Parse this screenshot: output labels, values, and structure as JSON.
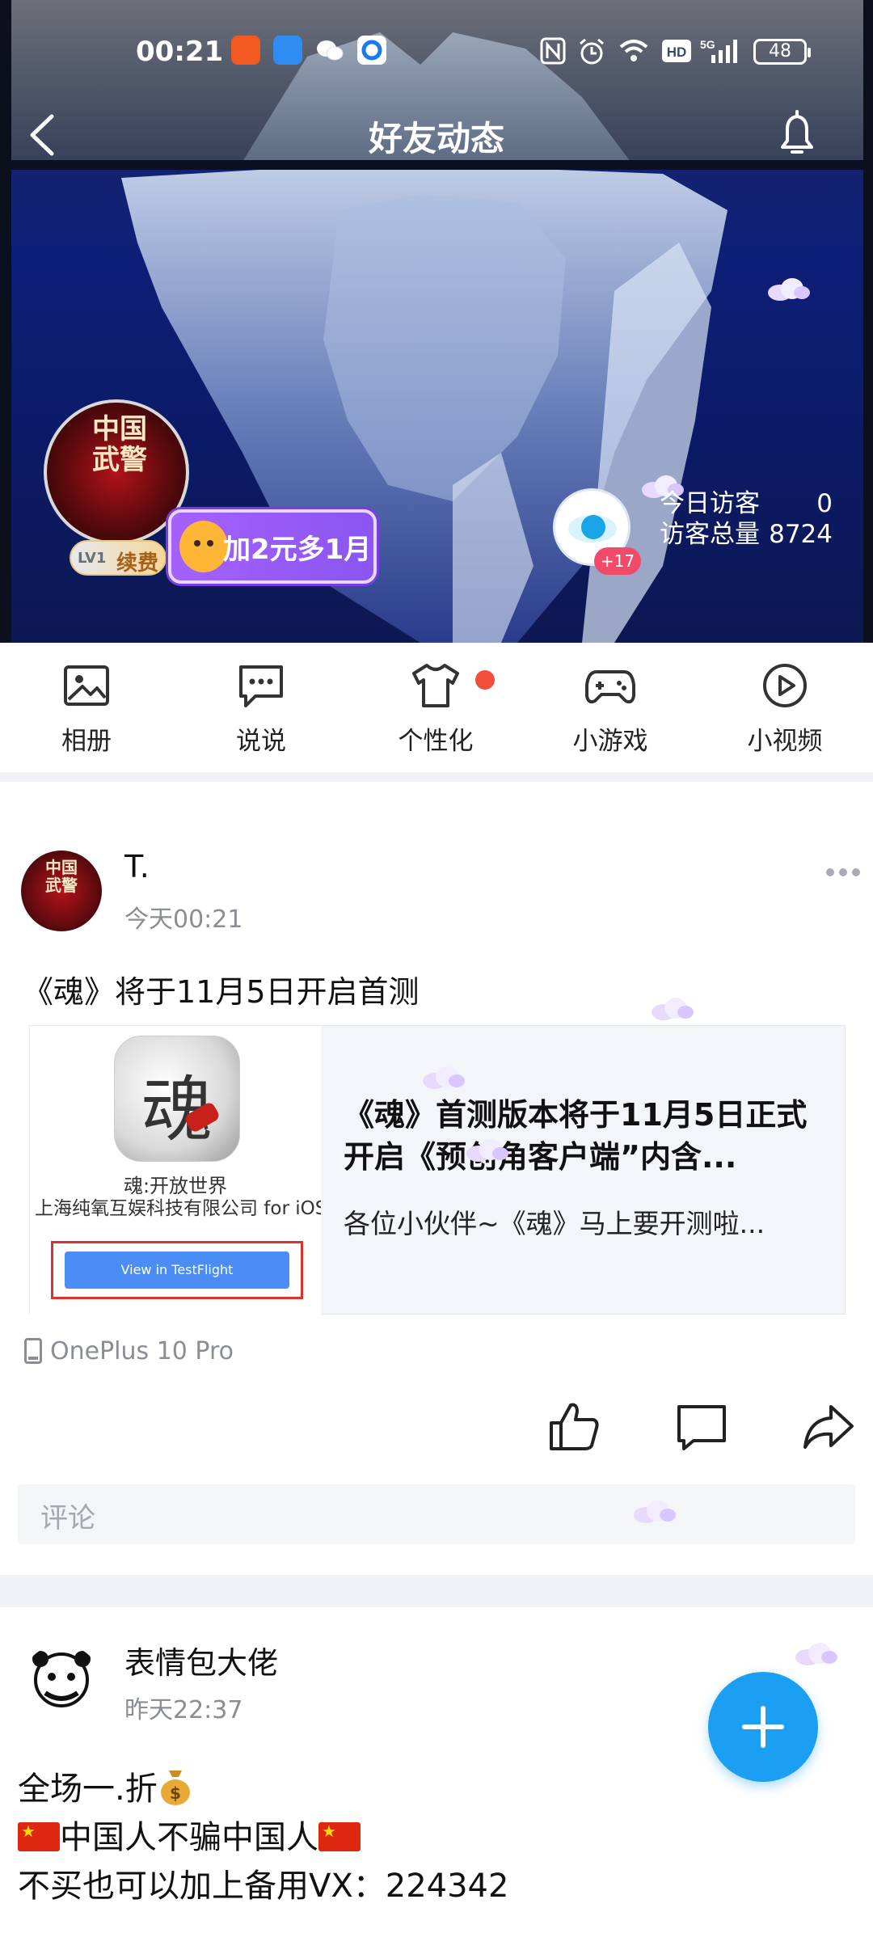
{
  "status_bar": {
    "time": "00:21",
    "battery": "48",
    "network": "5G"
  },
  "header": {
    "title": "好友动态"
  },
  "profile": {
    "avatar_text": "中国武警",
    "level": "LV1",
    "renew_label": "续费",
    "promo_label": "加2元多1月",
    "visitor_plus": "+17",
    "today_visitors_label": "今日访客",
    "today_visitors_value": "0",
    "total_visitors_label": "访客总量",
    "total_visitors_value": "8724"
  },
  "shortcuts": [
    {
      "label": "相册",
      "icon": "photo-album-icon"
    },
    {
      "label": "说说",
      "icon": "chat-bubble-icon"
    },
    {
      "label": "个性化",
      "icon": "tshirt-icon"
    },
    {
      "label": "小游戏",
      "icon": "gamepad-icon"
    },
    {
      "label": "小视频",
      "icon": "play-circle-icon"
    }
  ],
  "post1": {
    "author": "T.",
    "time": "今天00:21",
    "avatar_text": "中国武警",
    "text": "《魂》将于11月5日开启首测",
    "card": {
      "app_glyph": "魂",
      "app_name": "魂:开放世界",
      "app_company": "上海纯氧互娱科技有限公司 for iOS",
      "testflight_button": "View in TestFlight",
      "title": "《魂》首测版本将于11月5日正式开启《预创角客户端”内含...",
      "description": "各位小伙伴~《魂》马上要开测啦..."
    },
    "device": "OnePlus 10 Pro",
    "comment_placeholder": "评论"
  },
  "post2": {
    "author": "表情包大佬",
    "time": "昨天22:37",
    "line1": "全场一.折",
    "line2": "中国人不骗中国人",
    "line3": "不买也可以加上备用VX：224342"
  },
  "colors": {
    "accent_blue": "#1a9ff2",
    "notify_red": "#f24e3c",
    "promo_purple": "#a561ff"
  }
}
